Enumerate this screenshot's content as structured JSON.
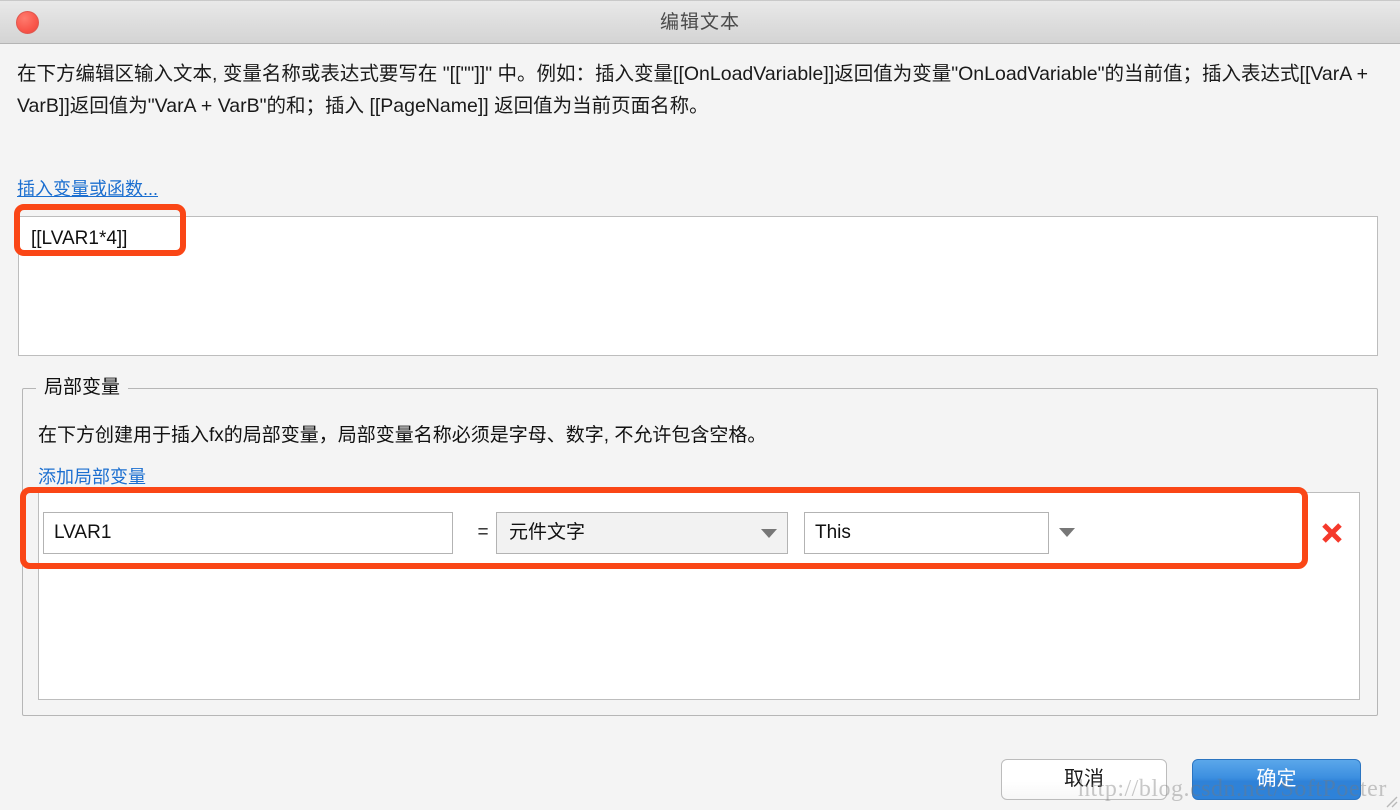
{
  "window": {
    "title": "编辑文本",
    "close_icon": "close-circle-icon"
  },
  "description": "在下方编辑区输入文本, 变量名称或表达式要写在 \"[[\"\"]]\" 中。例如：插入变量[[OnLoadVariable]]返回值为变量\"OnLoadVariable\"的当前值；插入表达式[[VarA + VarB]]返回值为\"VarA + VarB\"的和；插入 [[PageName]] 返回值为当前页面名称。",
  "insert_link": {
    "label": "插入变量或函数..."
  },
  "editor": {
    "value": "[[LVAR1*4]]",
    "placeholder": ""
  },
  "local_variables": {
    "legend": "局部变量",
    "description": "在下方创建用于插入fx的局部变量，局部变量名称必须是字母、数字, 不允许包含空格。",
    "add_link": "添加局部变量",
    "rows": [
      {
        "name": "LVAR1",
        "name_placeholder": "",
        "equals": "=",
        "type": "元件文字",
        "value": "This",
        "value_placeholder": "",
        "delete_icon": "delete-x-icon",
        "dropdown_icon": "chevron-down-icon"
      }
    ]
  },
  "footer": {
    "cancel_label": "取消",
    "ok_label": "确定"
  },
  "watermark": "http://blog.csdn.net/SoftPoeter",
  "colors": {
    "accent_blue": "#2e82d9",
    "link_blue": "#1c6fd0",
    "annotation_orange": "#fa4616",
    "delete_red": "#f5392b",
    "close_red": "#f9564b"
  }
}
